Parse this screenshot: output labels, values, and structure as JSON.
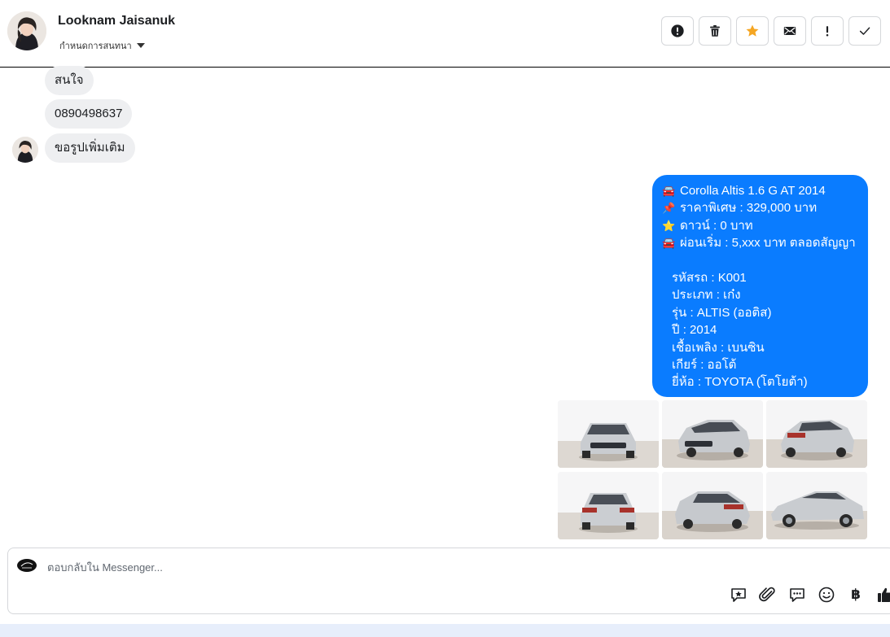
{
  "header": {
    "contact_name": "Looknam Jaisanuk",
    "subtitle": "กำหนดการสนทนา",
    "actions": [
      {
        "name": "spam-button",
        "icon": "alert-circle-icon"
      },
      {
        "name": "delete-button",
        "icon": "trash-icon"
      },
      {
        "name": "star-button",
        "icon": "star-icon"
      },
      {
        "name": "mark-unread-button",
        "icon": "envelope-icon"
      },
      {
        "name": "follow-up-button",
        "icon": "exclamation-icon"
      },
      {
        "name": "mark-done-button",
        "icon": "check-icon"
      }
    ],
    "star_color": "#f5a623"
  },
  "messages_in": [
    {
      "text": "สนใจ"
    },
    {
      "text": "0890498637"
    },
    {
      "text": "ขอรูปเพิ่มเติม"
    }
  ],
  "message_out": {
    "lines": [
      {
        "icon": "🚘",
        "text": "Corolla Altis 1.6 G  AT 2014"
      },
      {
        "icon": "📌",
        "text": "ราคาพิเศษ : 329,000 บาท"
      },
      {
        "icon": "⭐",
        "text": "ดาวน์ : 0 บาท"
      },
      {
        "icon": "🚘",
        "text": "ผ่อนเริ่ม : 5,xxx บาท ตลอดสัญญา"
      }
    ],
    "details": [
      "รหัสรถ : K001",
      "ประเภท : เก๋ง",
      "รุ่น : ALTIS (ออติส)",
      "ปี : 2014",
      "เชื้อเพลิง : เบนซิน",
      "เกียร์ : ออโต้",
      "ยี่ห้อ : TOYOTA (โตโยต้า)"
    ],
    "bubble_color": "#0a7cff"
  },
  "photos": [
    {
      "view": "front"
    },
    {
      "view": "front-left"
    },
    {
      "view": "rear-right"
    },
    {
      "view": "rear"
    },
    {
      "view": "rear-left"
    },
    {
      "view": "side"
    }
  ],
  "composer": {
    "placeholder": "ตอบกลับใน Messenger...",
    "tools": [
      "saved-reply-icon",
      "attachment-icon",
      "chat-bubble-icon",
      "emoji-icon",
      "baht-icon",
      "thumbs-up-icon"
    ],
    "baht_symbol": "฿"
  }
}
